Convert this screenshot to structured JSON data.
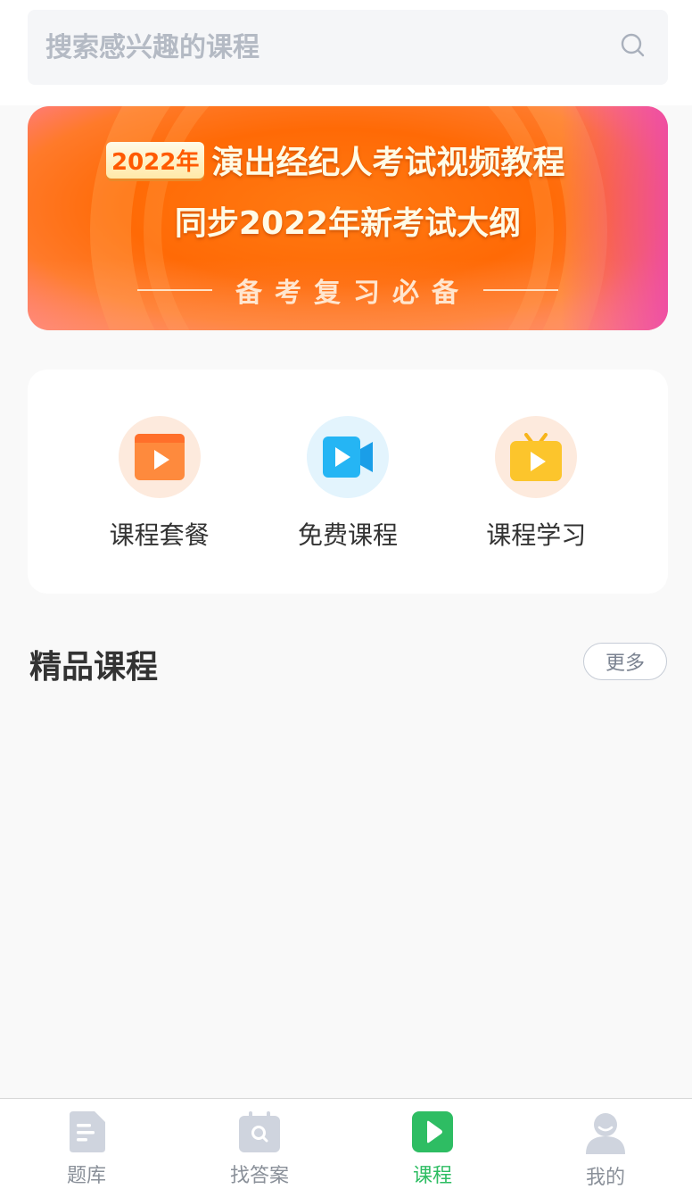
{
  "search": {
    "placeholder": "搜索感兴趣的课程"
  },
  "banner": {
    "year_badge": "2022年",
    "title": "演出经纪人考试视频教程",
    "subtitle": "同步2022年新考试大纲",
    "tagline": "备考复习必备"
  },
  "menu": {
    "items": [
      {
        "label": "课程套餐",
        "icon": "course-package-icon",
        "bg": "#fdeadd"
      },
      {
        "label": "免费课程",
        "icon": "video-camera-icon",
        "bg": "#e3f4fd"
      },
      {
        "label": "课程学习",
        "icon": "tv-play-icon",
        "bg": "#fdeadd"
      }
    ]
  },
  "section": {
    "title": "精品课程",
    "more_label": "更多"
  },
  "tabbar": {
    "items": [
      {
        "label": "题库",
        "icon": "document-icon",
        "active": false
      },
      {
        "label": "找答案",
        "icon": "calendar-search-icon",
        "active": false
      },
      {
        "label": "课程",
        "icon": "play-icon",
        "active": true
      },
      {
        "label": "我的",
        "icon": "user-icon",
        "active": false
      }
    ],
    "active_color": "#2ebd63",
    "inactive_color": "#8a9099"
  }
}
